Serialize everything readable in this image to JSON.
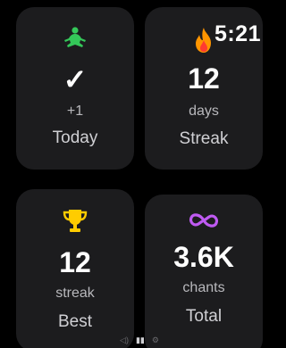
{
  "clock": {
    "time": "5:21"
  },
  "cards": {
    "today": {
      "icon": "meditation-icon",
      "checkmark": "✓",
      "sub": "+1",
      "label": "Today"
    },
    "streak": {
      "icon": "flame-icon",
      "value": "12",
      "sub": "days",
      "label": "Streak"
    },
    "best": {
      "icon": "trophy-icon",
      "value": "12",
      "sub": "streak",
      "label": "Best"
    },
    "total": {
      "icon": "infinity-icon",
      "value": "3.6K",
      "sub": "chants",
      "label": "Total"
    }
  },
  "page_indicator": {
    "items": [
      "speaker-icon",
      "signal-icon",
      "gear-icon"
    ]
  },
  "colors": {
    "card_bg": "#1c1c1e",
    "meditation": "#34c759",
    "flame": "#ff9500",
    "trophy": "#ffcc00",
    "infinity": "#bf5af2"
  }
}
